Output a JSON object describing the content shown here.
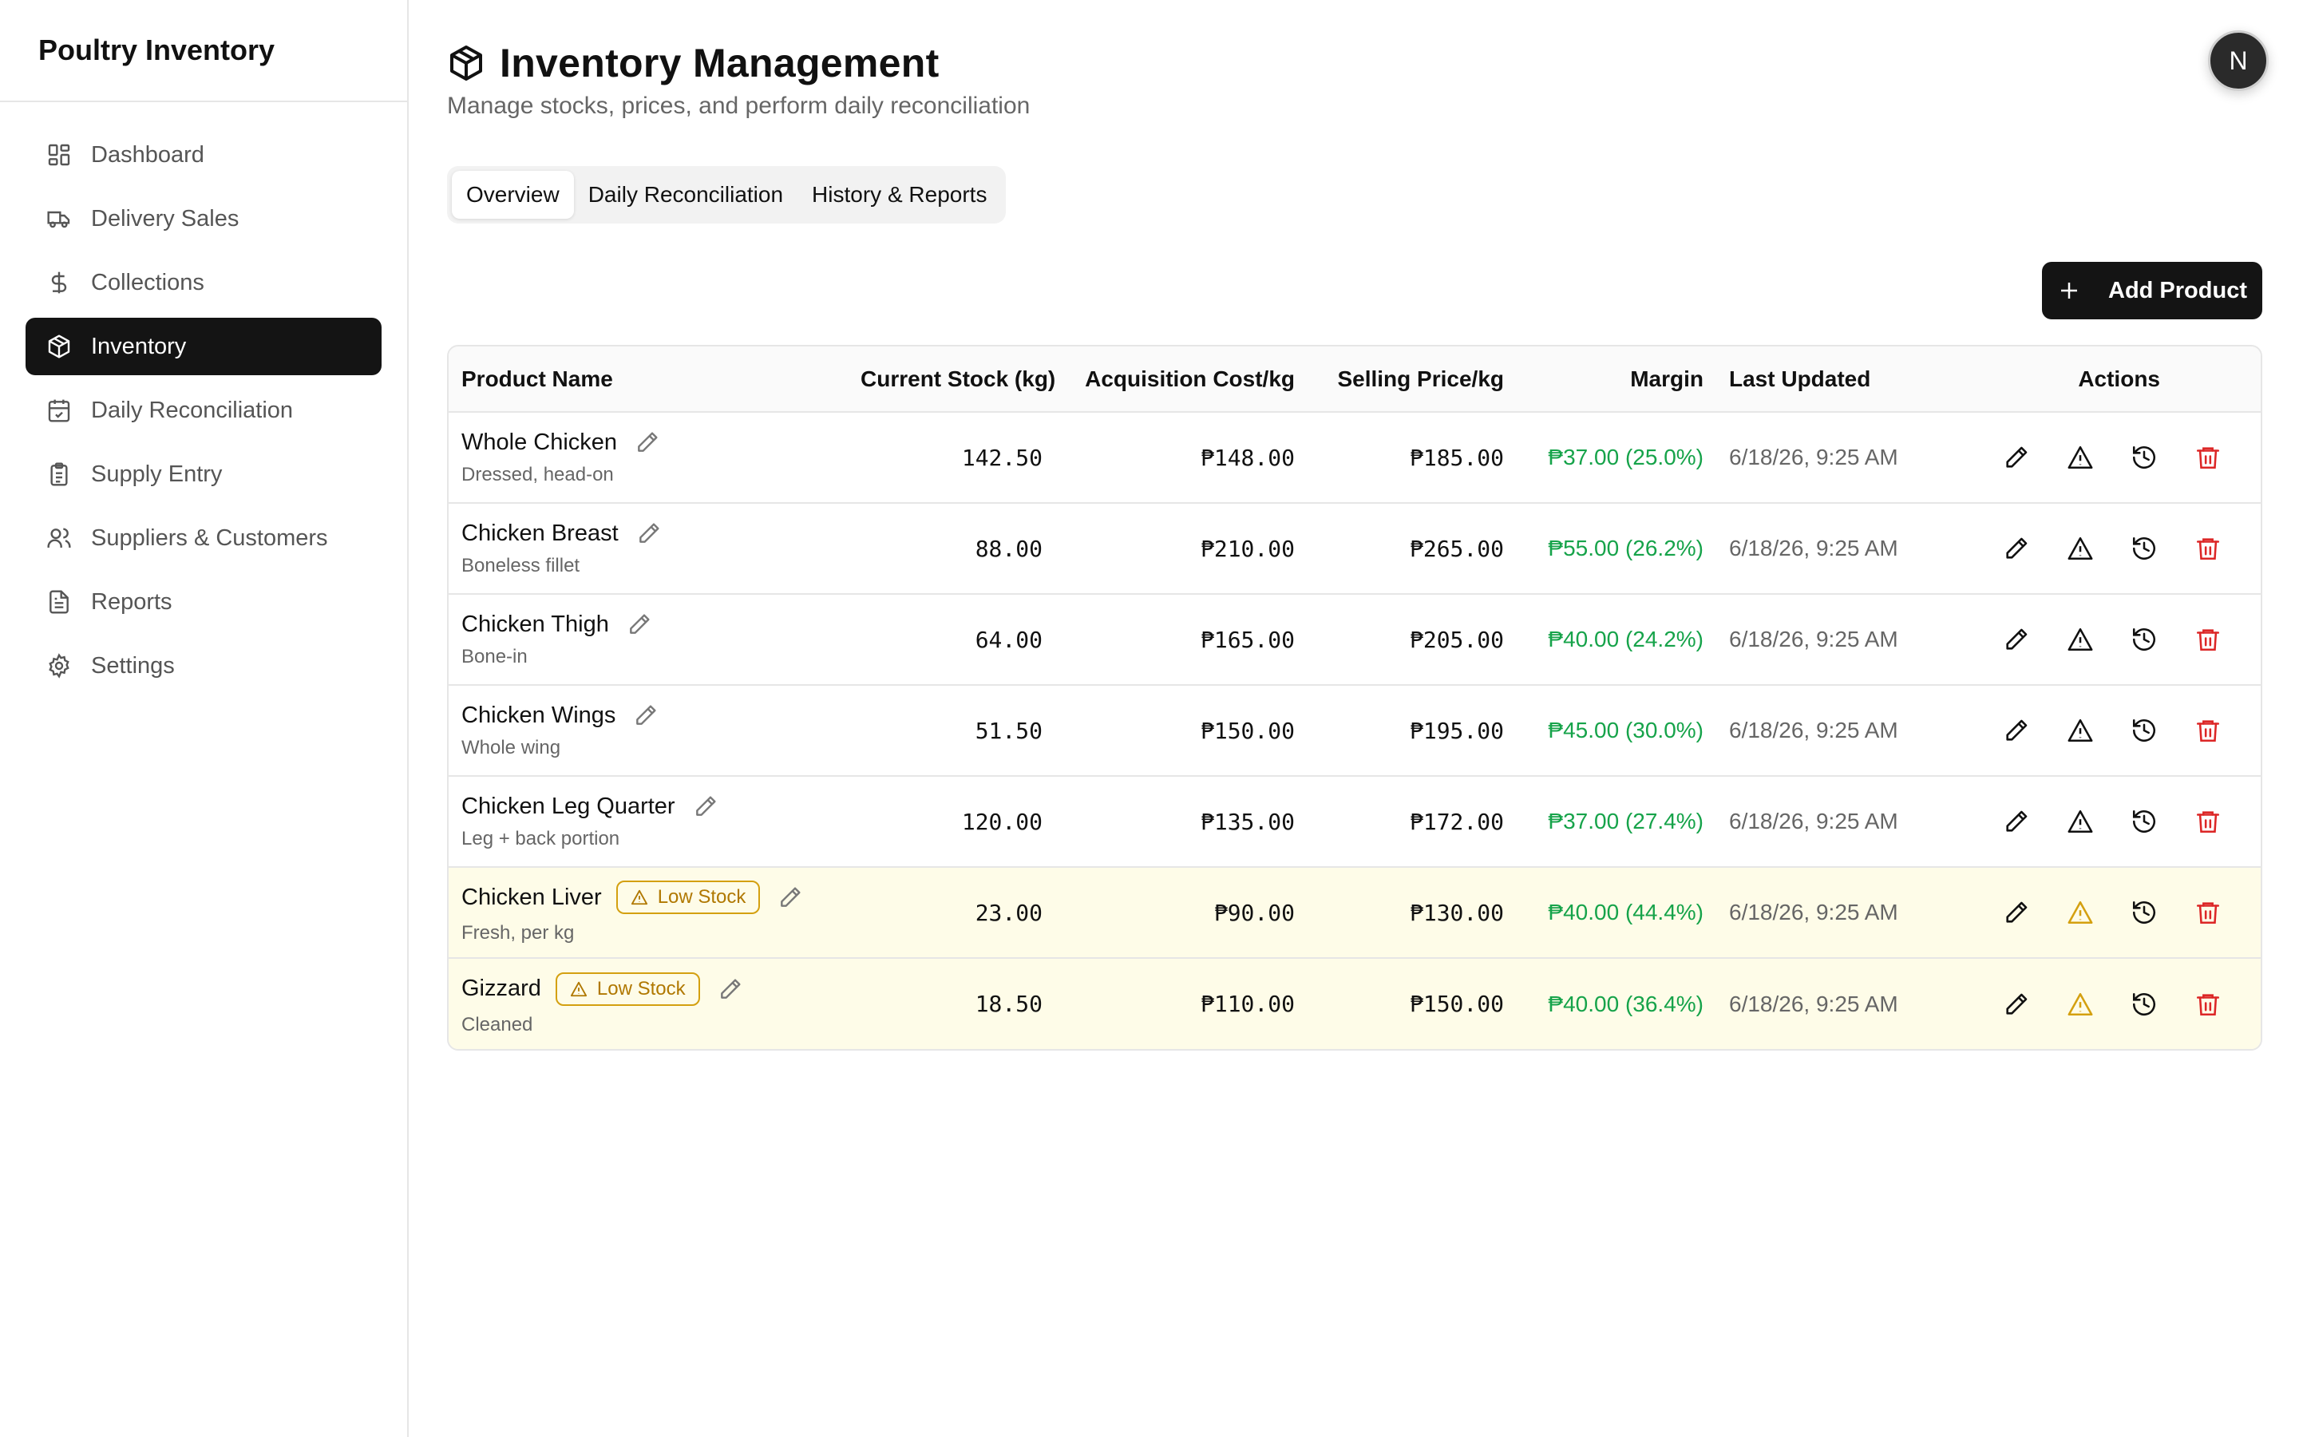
{
  "app": {
    "brand": "Poultry Inventory",
    "avatar_initial": "N"
  },
  "sidebar": {
    "items": [
      {
        "label": "Dashboard",
        "icon": "dashboard-icon"
      },
      {
        "label": "Delivery Sales",
        "icon": "truck-icon"
      },
      {
        "label": "Collections",
        "icon": "dollar-icon"
      },
      {
        "label": "Inventory",
        "icon": "package-icon",
        "active": true
      },
      {
        "label": "Daily Reconciliation",
        "icon": "calendar-check-icon"
      },
      {
        "label": "Supply Entry",
        "icon": "clipboard-icon"
      },
      {
        "label": "Suppliers & Customers",
        "icon": "users-icon"
      },
      {
        "label": "Reports",
        "icon": "file-text-icon"
      },
      {
        "label": "Settings",
        "icon": "gear-icon"
      }
    ]
  },
  "header": {
    "title": "Inventory Management",
    "subtitle": "Manage stocks, prices, and perform daily reconciliation"
  },
  "tabs": [
    {
      "label": "Overview",
      "active": true
    },
    {
      "label": "Daily Reconciliation"
    },
    {
      "label": "History & Reports"
    }
  ],
  "toolbar": {
    "add_label": "Add Product"
  },
  "table": {
    "headers": {
      "name": "Product Name",
      "stock": "Current Stock (kg)",
      "cost": "Acquisition Cost/kg",
      "price": "Selling Price/kg",
      "margin": "Margin",
      "updated": "Last Updated",
      "actions": "Actions"
    },
    "rows": [
      {
        "name": "Whole Chicken",
        "desc": "Dressed, head-on",
        "stock": "142.50",
        "cost": "₱148.00",
        "price": "₱185.00",
        "margin": "₱37.00 (25.0%)",
        "updated": "6/18/26, 9:25 AM",
        "badge": ""
      },
      {
        "name": "Chicken Breast",
        "desc": "Boneless fillet",
        "stock": "88.00",
        "cost": "₱210.00",
        "price": "₱265.00",
        "margin": "₱55.00 (26.2%)",
        "updated": "6/18/26, 9:25 AM",
        "badge": ""
      },
      {
        "name": "Chicken Thigh",
        "desc": "Bone-in",
        "stock": "64.00",
        "cost": "₱165.00",
        "price": "₱205.00",
        "margin": "₱40.00 (24.2%)",
        "updated": "6/18/26, 9:25 AM",
        "badge": ""
      },
      {
        "name": "Chicken Wings",
        "desc": "Whole wing",
        "stock": "51.50",
        "cost": "₱150.00",
        "price": "₱195.00",
        "margin": "₱45.00 (30.0%)",
        "updated": "6/18/26, 9:25 AM",
        "badge": ""
      },
      {
        "name": "Chicken Leg Quarter",
        "desc": "Leg + back portion",
        "stock": "120.00",
        "cost": "₱135.00",
        "price": "₱172.00",
        "margin": "₱37.00 (27.4%)",
        "updated": "6/18/26, 9:25 AM",
        "badge": ""
      },
      {
        "name": "Chicken Liver",
        "desc": "Fresh, per kg",
        "stock": "23.00",
        "cost": "₱90.00",
        "price": "₱130.00",
        "margin": "₱40.00 (44.4%)",
        "updated": "6/18/26, 9:25 AM",
        "badge": "Low Stock"
      },
      {
        "name": "Gizzard",
        "desc": "Cleaned",
        "stock": "18.50",
        "cost": "₱110.00",
        "price": "₱150.00",
        "margin": "₱40.00 (36.4%)",
        "updated": "6/18/26, 9:25 AM",
        "badge": "Low Stock"
      }
    ]
  },
  "colors": {
    "accent_dark": "#141414",
    "margin_green": "#16a34a",
    "low_stock_bg": "#fefce8",
    "warning_amber": "#d4a010",
    "danger_red": "#dc2626"
  }
}
